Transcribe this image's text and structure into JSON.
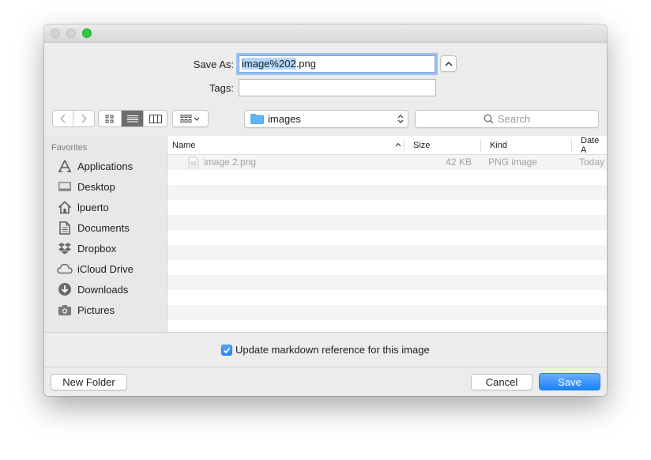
{
  "dialog": {
    "save_as_label": "Save As:",
    "filename_selected": "image%202",
    "filename_ext": ".png",
    "tags_label": "Tags:",
    "tags_value": ""
  },
  "toolbar": {
    "location": "images",
    "search_placeholder": "Search"
  },
  "sidebar": {
    "header": "Favorites",
    "items": [
      {
        "label": "Applications",
        "icon": "applications-icon"
      },
      {
        "label": "Desktop",
        "icon": "desktop-icon"
      },
      {
        "label": "lpuerto",
        "icon": "home-icon"
      },
      {
        "label": "Documents",
        "icon": "documents-icon"
      },
      {
        "label": "Dropbox",
        "icon": "dropbox-icon"
      },
      {
        "label": "iCloud Drive",
        "icon": "cloud-icon"
      },
      {
        "label": "Downloads",
        "icon": "downloads-icon"
      },
      {
        "label": "Pictures",
        "icon": "pictures-icon"
      }
    ]
  },
  "file_list": {
    "columns": [
      "Name",
      "Size",
      "Kind",
      "Date A"
    ],
    "sort_column": "Name",
    "rows": [
      {
        "name": "image 2.png",
        "size": "42 KB",
        "kind": "PNG image",
        "date": "Today"
      }
    ]
  },
  "options": {
    "update_reference_label": "Update markdown reference for this image",
    "update_reference_checked": true
  },
  "footer": {
    "new_folder": "New Folder",
    "cancel": "Cancel",
    "save": "Save"
  },
  "colors": {
    "accent": "#1a82fb",
    "selection": "#b3d7ff",
    "close_button_active": "#2ec843"
  }
}
